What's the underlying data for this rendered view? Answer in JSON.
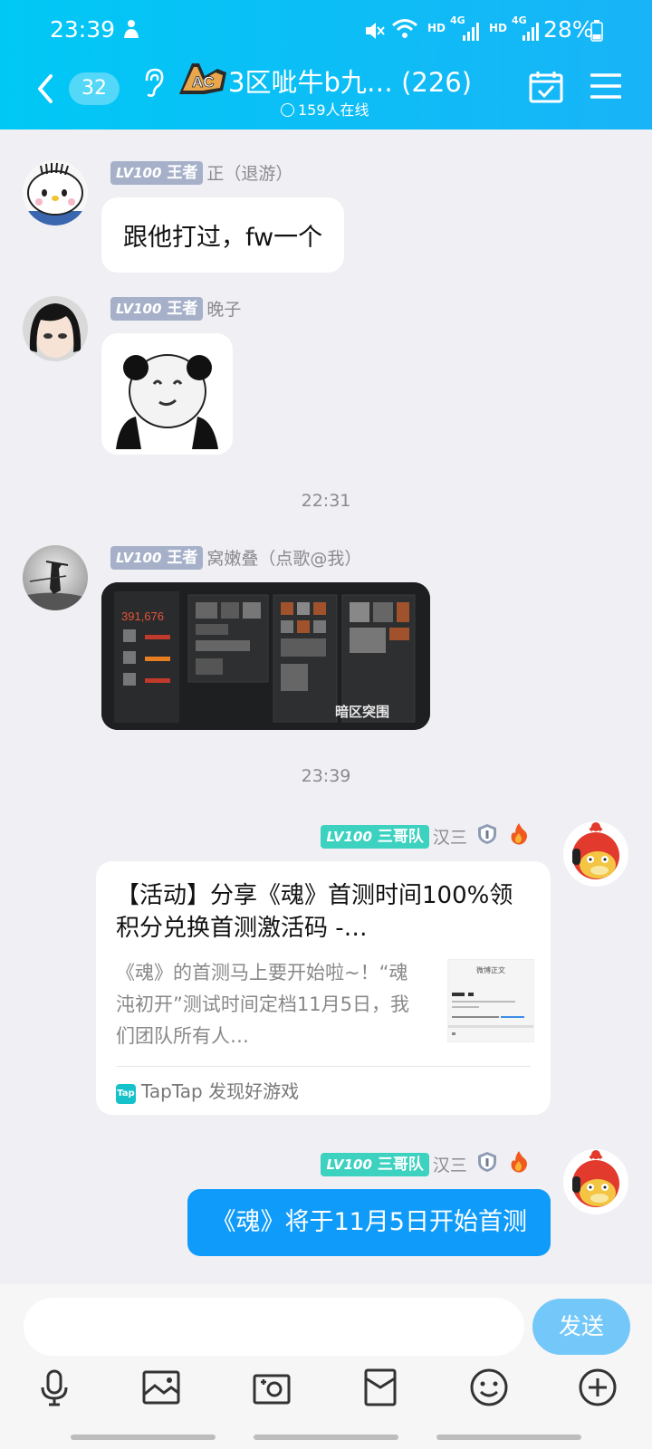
{
  "status_bar": {
    "time": "23:39",
    "battery": "28%",
    "net_label_1": "HD",
    "net_label_2": "HD",
    "net_gen_1": "4G",
    "net_gen_2": "4G"
  },
  "header": {
    "unread_count": "32",
    "group_title": "3区呲牛b九… (226)",
    "online": "159人在线",
    "logo_text": "AC"
  },
  "messages": [
    {
      "level": "LV100",
      "title": "王者",
      "name": "正（退游）",
      "text": "跟他打过，fw一个"
    },
    {
      "level": "LV100",
      "title": "王者",
      "name": "晚子"
    },
    {
      "timestamp": "22:31"
    },
    {
      "level": "LV100",
      "title": "王者",
      "name": "窝嫩叠（点歌@我）",
      "screenshot_value": "391,676",
      "screenshot_logo": "暗区突围"
    },
    {
      "timestamp": "23:39"
    },
    {
      "level": "LV100",
      "title": "三哥队",
      "name": "汉三",
      "card": {
        "title": "【活动】分享《魂》首测时间100%领积分兑换首测激活码 -…",
        "desc": "《魂》的首测马上要开始啦~！“魂沌初开”测试时间定档11月5日，我们团队所有人…",
        "thumb_title": "微博正文",
        "source": "TapTap 发现好游戏",
        "source_logo": "Tap"
      }
    },
    {
      "level": "LV100",
      "title": "三哥队",
      "name": "汉三",
      "text": "《魂》将于11月5日开始首测"
    }
  ],
  "input": {
    "send_label": "发送"
  },
  "colors": {
    "header": "#18b4f7",
    "blue_bubble": "#0f9bf9",
    "send_button": "#74c8f9",
    "level_badge": "#a6b1c9",
    "level_badge_team": "#3dd1c0"
  },
  "icons": [
    "back-icon",
    "ear-icon",
    "calendar-check-icon",
    "menu-icon",
    "microphone-icon",
    "image-icon",
    "camera-icon",
    "red-packet-icon",
    "emoji-icon",
    "plus-icon",
    "shield-icon",
    "fire-icon"
  ]
}
